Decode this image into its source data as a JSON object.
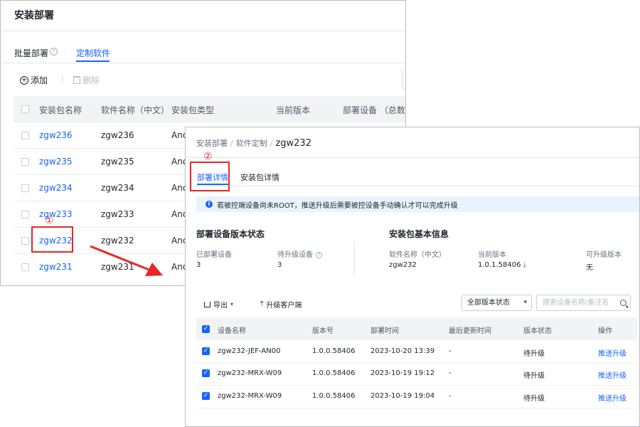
{
  "back": {
    "title": "安装部署",
    "tabs": [
      "批量部署",
      "定制软件"
    ],
    "tab_help": "?",
    "toolbar": {
      "add": "添加",
      "delete": "删除"
    },
    "columns": [
      "安装包名称",
      "软件名称（中文）",
      "安装包类型",
      "当前版本",
      "部署设备 （总数)"
    ],
    "rows": [
      {
        "package": "zgw236",
        "software": "zgw236",
        "type": "And"
      },
      {
        "package": "zgw235",
        "software": "zgw235",
        "type": "And"
      },
      {
        "package": "zgw234",
        "software": "zgw234",
        "type": "And"
      },
      {
        "package": "zgw233",
        "software": "zgw233",
        "type": "And"
      },
      {
        "package": "zgw232",
        "software": "zgw232",
        "type": "And"
      },
      {
        "package": "zgw231",
        "software": "zgw231",
        "type": "And"
      }
    ]
  },
  "annotations": {
    "step1": "①",
    "step2": "②"
  },
  "front": {
    "breadcrumb": [
      "安装部署",
      "软件定制",
      "zgw232"
    ],
    "tabs": [
      "部署详情",
      "安装包详情"
    ],
    "notice": "若被控端设备尚未ROOT，推送升级后需要被控设备手动确认才可以完成升级",
    "deploy_status": {
      "title": "部署设备版本状态",
      "deployed_label": "已部署设备",
      "deployed_value": "3",
      "pending_label": "待升级设备",
      "pending_value": "3"
    },
    "package_info": {
      "title": "安装包基本信息",
      "name_label": "软件名称（中文）",
      "name_value": "zgw232",
      "version_label": "当前版本",
      "version_value": "1.0.1.58406",
      "upgradable_label": "可升级版本",
      "upgradable_value": "无"
    },
    "toolbar": {
      "export": "导出",
      "upgrade": "升级客户端",
      "status_select": "全部版本状态",
      "search_placeholder": "搜索设备名称/备注名"
    },
    "columns": [
      "设备名称",
      "版本号",
      "部署时间",
      "最后更新时间",
      "版本状态",
      "操作"
    ],
    "rows": [
      {
        "device": "zgw232-JEF-AN00",
        "version": "1.0.0.58406",
        "deployed": "2023-10-20 13:39",
        "updated": "-",
        "status": "待升级",
        "action": "推送升级"
      },
      {
        "device": "zgw232-MRX-W09",
        "version": "1.0.0.58406",
        "deployed": "2023-10-19 19:12",
        "updated": "-",
        "status": "待升级",
        "action": "推送升级"
      },
      {
        "device": "zgw232-MRX-W09",
        "version": "1.0.0.58406",
        "deployed": "2023-10-19 19:04",
        "updated": "-",
        "status": "待升级",
        "action": "推送升级"
      }
    ]
  }
}
